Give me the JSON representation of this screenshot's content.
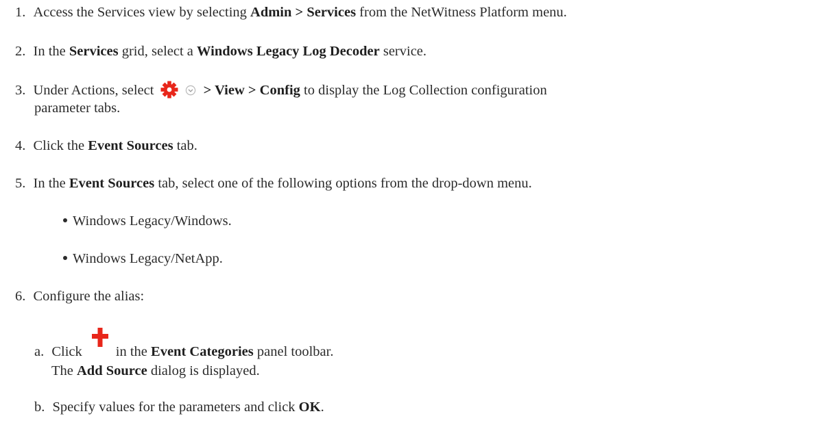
{
  "steps": [
    {
      "num": "1.",
      "t1": "Access the Services view by selecting ",
      "b1": "Admin > Services",
      "t2": " from the NetWitness Platform menu."
    },
    {
      "num": "2.",
      "t1": "In the ",
      "b1": "Services",
      "t2": " grid, select a ",
      "b2": "Windows Legacy Log Decoder",
      "t3": " service."
    },
    {
      "num": "3.",
      "t1": "Under Actions, select ",
      "b1": " > View > Config",
      "t2": " to display the Log Collection configuration",
      "cont": "parameter tabs."
    },
    {
      "num": "4.",
      "t1": "Click the ",
      "b1": "Event Sources",
      "t2": " tab."
    },
    {
      "num": "5.",
      "t1": "In the ",
      "b1": "Event Sources",
      "t2": " tab, select one of the following options from the drop-down menu."
    },
    {
      "num": "6.",
      "t1": "Configure the alias:"
    }
  ],
  "bullets": [
    "Windows Legacy/Windows.",
    "Windows Legacy/NetApp."
  ],
  "substeps": [
    {
      "letter": "a.",
      "t1": "Click",
      "t2": "in the ",
      "b1": "Event Categories",
      "t3": " panel toolbar.",
      "note_b": "Add Source",
      "note_t": " dialog is displayed.",
      "note_pre": "The "
    },
    {
      "letter": "b.",
      "t1": "Specify values for the parameters and click ",
      "b1": "OK",
      "t2": "."
    }
  ],
  "icons": {
    "gear": "gear-icon",
    "chevron": "chevron-down-icon",
    "plus": "plus-icon",
    "gear_color": "#e8261a",
    "plus_color": "#e8261a"
  }
}
